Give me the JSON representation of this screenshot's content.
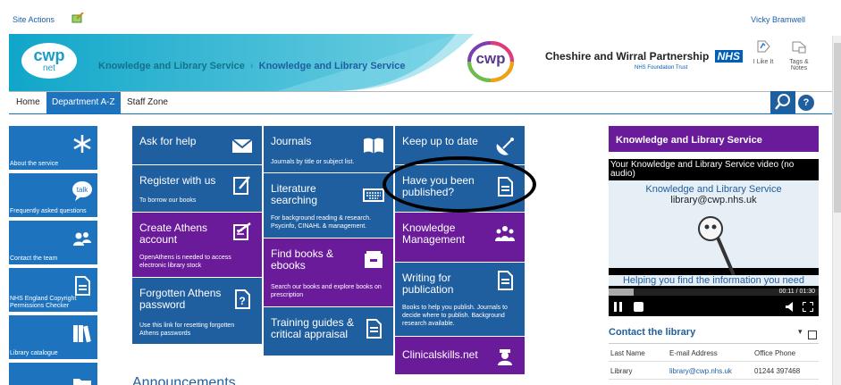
{
  "topbar": {
    "site_actions": "Site Actions",
    "user": "Vicky Bramwell"
  },
  "header": {
    "logo_top": "cwp",
    "logo_bottom": "net",
    "breadcrumb_1": "Knowledge and Library Service",
    "breadcrumb_sep": "›",
    "breadcrumb_2": "Knowledge and Library Service",
    "brand_logo": "cwp",
    "partnership": "Cheshire and Wirral Partnership",
    "nhs": "NHS",
    "trust": "NHS Foundation Trust",
    "like_label": "I Like It",
    "tags_label": "Tags & Notes"
  },
  "nav": {
    "tabs": [
      "Home",
      "Department A-Z",
      "Staff Zone"
    ],
    "help": "?"
  },
  "quicklinks": [
    {
      "label": "About the service",
      "icon": "asterisk-icon"
    },
    {
      "label": "Frequently asked questions",
      "icon": "talk-bubble-icon"
    },
    {
      "label": "Contact the team",
      "icon": "people-icon"
    },
    {
      "label": "NHS England Copyright Permissions Checker",
      "icon": "document-icon"
    },
    {
      "label": "Library catalogue",
      "icon": "books-icon"
    }
  ],
  "tiles": {
    "ask": {
      "title": "Ask for help",
      "desc": ""
    },
    "register": {
      "title": "Register with us",
      "desc": "To borrow our books"
    },
    "athens": {
      "title": "Create Athens account",
      "desc": "OpenAthens is needed to access electronic library stock"
    },
    "forgot": {
      "title": "Forgotten Athens password",
      "desc": "Use this link for resetting forgotten Athens passwords"
    },
    "journals": {
      "title": "Journals",
      "desc": "Journals by title or subject list."
    },
    "lit": {
      "title": "Literature searching",
      "desc": "For background reading & research. Psycinfo, CINAHL & management."
    },
    "books": {
      "title": "Find books & ebooks",
      "desc": "Search our books and explore books on prescription"
    },
    "training": {
      "title": "Training guides & critical appraisal",
      "desc": ""
    },
    "update": {
      "title": "Keep up to date",
      "desc": ""
    },
    "published": {
      "title": "Have you been published?",
      "desc": ""
    },
    "km": {
      "title": "Knowledge Management",
      "desc": ""
    },
    "writing": {
      "title": "Writing for publication",
      "desc": "Books to help you publish. Journals to decide where to publish. Background research available."
    },
    "clinical": {
      "title": "Clinicalskills.net",
      "desc": ""
    }
  },
  "side": {
    "title": "Knowledge and Library Service",
    "video_title": "Your Knowledge and Library Service video (no audio)",
    "video_h1": "Knowledge and Library Service",
    "video_h2": "library@cwp.nhs.uk",
    "video_h3": "Helping you find the information you need",
    "video_time": "00:11 / 01:30",
    "video_progress": 0.12
  },
  "contact": {
    "title": "Contact the library",
    "headers": [
      "Last Name",
      "E-mail Address",
      "Office Phone"
    ],
    "rows": [
      [
        "Library",
        "library@cwp.nhs.uk",
        "01244 397468"
      ]
    ]
  },
  "main": {
    "announcements": "Announcements"
  },
  "colors": {
    "blue": "#1f5fa0",
    "purple": "#6a1b9a",
    "light_blue": "#1e73be",
    "teal": "#1a9cc7"
  }
}
